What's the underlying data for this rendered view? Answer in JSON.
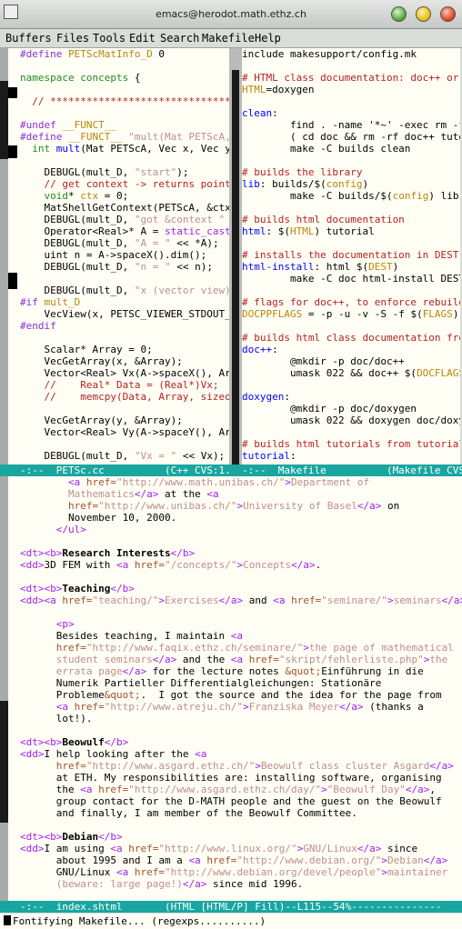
{
  "window": {
    "title": "emacs@herodot.math.ethz.ch"
  },
  "menu": [
    "Buffers",
    "Files",
    "Tools",
    "Edit",
    "Search",
    "Makefile",
    "Help"
  ],
  "left_pane": {
    "lines": [
      [
        [
          "pre",
          "#define "
        ],
        [
          "var",
          "PETScMatInfo_D"
        ],
        [
          "def",
          " 0"
        ]
      ],
      [
        [
          "def",
          ""
        ]
      ],
      [
        [
          "type",
          "namespace"
        ],
        [
          "def",
          " "
        ],
        [
          "type",
          "concepts"
        ],
        [
          "def",
          " {"
        ]
      ],
      [
        [
          "def",
          ""
        ]
      ],
      [
        [
          "com",
          "  // ************************************$"
        ]
      ],
      [
        [
          "def",
          ""
        ]
      ],
      [
        [
          "pre",
          "#undef "
        ],
        [
          "var",
          "__FUNCT__"
        ]
      ],
      [
        [
          "pre",
          "#define "
        ],
        [
          "var",
          "__FUNCT__"
        ],
        [
          "str",
          " \"mult(Mat PETScA, V$"
        ]
      ],
      [
        [
          "def",
          "  "
        ],
        [
          "type",
          "int"
        ],
        [
          "def",
          " "
        ],
        [
          "fn",
          "mult"
        ],
        [
          "def",
          "(Mat PETScA, Vec x, Vec y) $"
        ]
      ],
      [
        [
          "def",
          ""
        ]
      ],
      [
        [
          "def",
          "    DEBUGL(mult_D, "
        ],
        [
          "str",
          "\"start\""
        ],
        [
          "def",
          ");"
        ]
      ],
      [
        [
          "com",
          "    // get context -> returns pointer$"
        ]
      ],
      [
        [
          "def",
          "    "
        ],
        [
          "type",
          "void"
        ],
        [
          "def",
          "* "
        ],
        [
          "var",
          "ctx"
        ],
        [
          "def",
          " = 0;"
        ]
      ],
      [
        [
          "def",
          "    MatShellGetContext(PETScA, &ctx);$"
        ]
      ],
      [
        [
          "def",
          "    DEBUGL(mult_D, "
        ],
        [
          "str",
          "\"got &context \""
        ],
        [
          "def",
          " <<$"
        ]
      ],
      [
        [
          "def",
          "    Operator<Real>* A = "
        ],
        [
          "kw",
          "static_cast"
        ],
        [
          "type",
          "<O$"
        ]
      ],
      [
        [
          "def",
          "    DEBUGL(mult_D, "
        ],
        [
          "str",
          "\"A = \""
        ],
        [
          "def",
          " << *A);"
        ]
      ],
      [
        [
          "def",
          "    uint n = A->spaceX().dim();"
        ]
      ],
      [
        [
          "def",
          "    DEBUGL(mult_D, "
        ],
        [
          "str",
          "\"n = \""
        ],
        [
          "def",
          " << n);"
        ]
      ],
      [
        [
          "def",
          ""
        ]
      ],
      [
        [
          "def",
          "    DEBUGL(mult_D, "
        ],
        [
          "str",
          "\"x (vector view)\""
        ],
        [
          "def",
          ")$"
        ]
      ],
      [
        [
          "pre",
          "#if "
        ],
        [
          "var",
          "mult_D"
        ]
      ],
      [
        [
          "def",
          "    VecView(x, PETSC_VIEWER_STDOUT_SE$"
        ]
      ],
      [
        [
          "pre",
          "#endif"
        ]
      ],
      [
        [
          "def",
          ""
        ]
      ],
      [
        [
          "def",
          "    Scalar* Array = 0;"
        ]
      ],
      [
        [
          "def",
          "    VecGetArray(x, &Array);"
        ]
      ],
      [
        [
          "def",
          "    Vector<Real> Vx(A->spaceX(), Arra$"
        ]
      ],
      [
        [
          "com",
          "    //    Real* Data = (Real*)Vx;"
        ]
      ],
      [
        [
          "com",
          "    //    memcpy(Data, Array, sizeof($"
        ]
      ],
      [
        [
          "def",
          ""
        ]
      ],
      [
        [
          "def",
          "    VecGetArray(y, &Array);"
        ]
      ],
      [
        [
          "def",
          "    Vector<Real> Vy(A->spaceY(), Arra$"
        ]
      ],
      [
        [
          "def",
          ""
        ]
      ],
      [
        [
          "def",
          "    DEBUGL(mult_D, "
        ],
        [
          "str",
          "\"Vx = \""
        ],
        [
          "def",
          " << Vx);"
        ]
      ]
    ],
    "modeline": "-:--  PETSc.cc          (C++ CVS:1.1)-"
  },
  "right_pane": {
    "lines": [
      [
        [
          "def",
          "include makesupport/config.mk"
        ]
      ],
      [
        [
          "def",
          ""
        ]
      ],
      [
        [
          "com",
          "# HTML class documentation: doc++ or d$"
        ]
      ],
      [
        [
          "var",
          "HTML"
        ],
        [
          "def",
          "=doxygen"
        ]
      ],
      [
        [
          "def",
          ""
        ]
      ],
      [
        [
          "fn",
          "clean"
        ],
        [
          "def",
          ":"
        ]
      ],
      [
        [
          "def",
          "        find . -name '*~' -exec rm -f $"
        ]
      ],
      [
        [
          "def",
          "        ( cd doc && rm -rf doc++ tutor$"
        ]
      ],
      [
        [
          "def",
          "        make -C builds clean"
        ]
      ],
      [
        [
          "def",
          ""
        ]
      ],
      [
        [
          "com",
          "# builds the library"
        ]
      ],
      [
        [
          "fn",
          "lib"
        ],
        [
          "def",
          ": builds/$("
        ],
        [
          "var",
          "config"
        ],
        [
          "def",
          ")"
        ]
      ],
      [
        [
          "def",
          "        make -C builds/$("
        ],
        [
          "var",
          "config"
        ],
        [
          "def",
          ") lib"
        ]
      ],
      [
        [
          "def",
          ""
        ]
      ],
      [
        [
          "com",
          "# builds html documentation"
        ]
      ],
      [
        [
          "fn",
          "html"
        ],
        [
          "def",
          ": $("
        ],
        [
          "var",
          "HTML"
        ],
        [
          "def",
          ") tutorial"
        ]
      ],
      [
        [
          "def",
          ""
        ]
      ],
      [
        [
          "com",
          "# installs the documentation in DEST"
        ]
      ],
      [
        [
          "fn",
          "html-install"
        ],
        [
          "def",
          ": html $("
        ],
        [
          "var",
          "DEST"
        ],
        [
          "def",
          ")"
        ]
      ],
      [
        [
          "def",
          "        make -C doc html-install DEST=$"
        ]
      ],
      [
        [
          "def",
          ""
        ]
      ],
      [
        [
          "com",
          "# flags for doc++, to enforce rebuild $"
        ]
      ],
      [
        [
          "var",
          "DOCPPFLAGS"
        ],
        [
          "def",
          " = -p -u -v -S -f $("
        ],
        [
          "var",
          "FLAGS"
        ],
        [
          "def",
          ")"
        ]
      ],
      [
        [
          "def",
          ""
        ]
      ],
      [
        [
          "com",
          "# builds html class documentation from$"
        ]
      ],
      [
        [
          "fn",
          "doc++"
        ],
        [
          "def",
          ":"
        ]
      ],
      [
        [
          "def",
          "        @mkdir -p doc/doc++"
        ]
      ],
      [
        [
          "def",
          "        umask 022 && doc++ $("
        ],
        [
          "var",
          "DOCFLAGS"
        ],
        [
          "def",
          ")$"
        ]
      ],
      [
        [
          "def",
          ""
        ]
      ],
      [
        [
          "fn",
          "doxygen"
        ],
        [
          "def",
          ":"
        ]
      ],
      [
        [
          "def",
          "        @mkdir -p doc/doxygen"
        ]
      ],
      [
        [
          "def",
          "        umask 022 && doxygen doc/doxyg$"
        ]
      ],
      [
        [
          "def",
          ""
        ]
      ],
      [
        [
          "com",
          "# builds html tutorials from tutorial $"
        ]
      ],
      [
        [
          "fn",
          "tutorial"
        ],
        [
          "def",
          ":"
        ]
      ]
    ],
    "modeline": "-:--  Makefile          (Makefile CVS-1"
  },
  "bottom_pane": {
    "lines": [
      [
        [
          "def",
          "        "
        ],
        [
          "tag",
          "<a "
        ],
        [
          "attr",
          "href="
        ],
        [
          "str",
          "\"http://www.math.unibas.ch/\""
        ],
        [
          "tag",
          ">"
        ],
        [
          "str",
          "Department of"
        ]
      ],
      [
        [
          "def",
          "        "
        ],
        [
          "str",
          "Mathematics"
        ],
        [
          "tag",
          "</a>"
        ],
        [
          "def",
          " at the "
        ],
        [
          "tag",
          "<a"
        ]
      ],
      [
        [
          "def",
          "        "
        ],
        [
          "attr",
          "href="
        ],
        [
          "str",
          "\"http://www.unibas.ch/\""
        ],
        [
          "tag",
          ">"
        ],
        [
          "str",
          "University of Basel"
        ],
        [
          "tag",
          "</a>"
        ],
        [
          "def",
          " on"
        ]
      ],
      [
        [
          "def",
          "        November 10, 2000."
        ]
      ],
      [
        [
          "def",
          "      "
        ],
        [
          "tag",
          "</ul>"
        ]
      ],
      [
        [
          "def",
          ""
        ]
      ],
      [
        [
          "tag",
          "<dt><b>"
        ],
        [
          "bold",
          "Research Interests"
        ],
        [
          "tag",
          "</b>"
        ]
      ],
      [
        [
          "tag",
          "<dd>"
        ],
        [
          "def",
          "3D FEM with "
        ],
        [
          "tag",
          "<a "
        ],
        [
          "attr",
          "href="
        ],
        [
          "str",
          "\"/concepts/\""
        ],
        [
          "tag",
          ">"
        ],
        [
          "str",
          "Concepts"
        ],
        [
          "tag",
          "</a>"
        ],
        [
          "def",
          "."
        ]
      ],
      [
        [
          "def",
          ""
        ]
      ],
      [
        [
          "tag",
          "<dt><b>"
        ],
        [
          "bold",
          "Teaching"
        ],
        [
          "tag",
          "</b>"
        ]
      ],
      [
        [
          "tag",
          "<dd><a "
        ],
        [
          "attr",
          "href="
        ],
        [
          "str",
          "\"teaching/\""
        ],
        [
          "tag",
          ">"
        ],
        [
          "str",
          "Exercises"
        ],
        [
          "tag",
          "</a>"
        ],
        [
          "def",
          " and "
        ],
        [
          "tag",
          "<a "
        ],
        [
          "attr",
          "href="
        ],
        [
          "str",
          "\"seminare/\""
        ],
        [
          "tag",
          ">"
        ],
        [
          "str",
          "seminars"
        ],
        [
          "tag",
          "</a>"
        ],
        [
          "def",
          "."
        ]
      ],
      [
        [
          "def",
          ""
        ]
      ],
      [
        [
          "def",
          "      "
        ],
        [
          "tag",
          "<p>"
        ]
      ],
      [
        [
          "def",
          "      Besides teaching, I maintain "
        ],
        [
          "tag",
          "<a"
        ]
      ],
      [
        [
          "def",
          "      "
        ],
        [
          "attr",
          "href="
        ],
        [
          "str",
          "\"http://www.faqix.ethz.ch/seminare/\""
        ],
        [
          "tag",
          ">"
        ],
        [
          "str",
          "the page of mathematical"
        ]
      ],
      [
        [
          "def",
          "      "
        ],
        [
          "str",
          "student seminars"
        ],
        [
          "tag",
          "</a>"
        ],
        [
          "def",
          " and the "
        ],
        [
          "tag",
          "<a "
        ],
        [
          "attr",
          "href="
        ],
        [
          "str",
          "\"skript/fehlerliste.php\""
        ],
        [
          "tag",
          ">"
        ],
        [
          "str",
          "the"
        ]
      ],
      [
        [
          "def",
          "      "
        ],
        [
          "str",
          "errata page"
        ],
        [
          "tag",
          "</a>"
        ],
        [
          "def",
          " for the lecture notes "
        ],
        [
          "attr",
          "&quot;"
        ],
        [
          "def",
          "Einführung in die"
        ]
      ],
      [
        [
          "def",
          "      Numerik Partieller Differentialgleichungen: Stationäre"
        ]
      ],
      [
        [
          "def",
          "      Probleme"
        ],
        [
          "attr",
          "&quot;"
        ],
        [
          "def",
          ".  I got the source and the idea for the page from"
        ]
      ],
      [
        [
          "def",
          "      "
        ],
        [
          "tag",
          "<a "
        ],
        [
          "attr",
          "href="
        ],
        [
          "str",
          "\"http://www.atreju.ch/\""
        ],
        [
          "tag",
          ">"
        ],
        [
          "str",
          "Franziska Meyer"
        ],
        [
          "tag",
          "</a>"
        ],
        [
          "def",
          " (thanks a"
        ]
      ],
      [
        [
          "def",
          "      lot!)."
        ]
      ],
      [
        [
          "def",
          ""
        ]
      ],
      [
        [
          "tag",
          "<dt><b>"
        ],
        [
          "bold",
          "Beowulf"
        ],
        [
          "tag",
          "</b>"
        ]
      ],
      [
        [
          "tag",
          "<dd>"
        ],
        [
          "def",
          "I help looking after the "
        ],
        [
          "tag",
          "<a"
        ]
      ],
      [
        [
          "def",
          "      "
        ],
        [
          "attr",
          "href="
        ],
        [
          "str",
          "\"http://www.asgard.ethz.ch/\""
        ],
        [
          "tag",
          ">"
        ],
        [
          "str",
          "Beowulf class cluster Asgard"
        ],
        [
          "tag",
          "</a>"
        ]
      ],
      [
        [
          "def",
          "      at ETH. My responsibilities are: installing software, organising"
        ]
      ],
      [
        [
          "def",
          "      the "
        ],
        [
          "tag",
          "<a "
        ],
        [
          "attr",
          "href="
        ],
        [
          "str",
          "\"http://www.asgard.ethz.ch/day/\""
        ],
        [
          "tag",
          ">"
        ],
        [
          "str",
          "\"Beowulf Day\""
        ],
        [
          "tag",
          "</a>"
        ],
        [
          "def",
          ","
        ]
      ],
      [
        [
          "def",
          "      group contact for the D-MATH people and the guest on the Beowulf"
        ]
      ],
      [
        [
          "def",
          "      and finally, I am member of the Beowulf Committee."
        ]
      ],
      [
        [
          "def",
          ""
        ]
      ],
      [
        [
          "tag",
          "<dt><b>"
        ],
        [
          "bold",
          "Debian"
        ],
        [
          "tag",
          "</b>"
        ]
      ],
      [
        [
          "tag",
          "<dd>"
        ],
        [
          "def",
          "I am using "
        ],
        [
          "tag",
          "<a "
        ],
        [
          "attr",
          "href="
        ],
        [
          "str",
          "\"http://www.linux.org/\""
        ],
        [
          "tag",
          ">"
        ],
        [
          "str",
          "GNU/Linux"
        ],
        [
          "tag",
          "</a>"
        ],
        [
          "def",
          " since"
        ]
      ],
      [
        [
          "def",
          "      about 1995 and I am a "
        ],
        [
          "tag",
          "<a "
        ],
        [
          "attr",
          "href="
        ],
        [
          "str",
          "\"http://www.debian.org/\""
        ],
        [
          "tag",
          ">"
        ],
        [
          "str",
          "Debian"
        ],
        [
          "tag",
          "</a>"
        ]
      ],
      [
        [
          "def",
          "      GNU/Linux "
        ],
        [
          "tag",
          "<a "
        ],
        [
          "attr",
          "href="
        ],
        [
          "str",
          "\"http://www.debian.org/devel/people\""
        ],
        [
          "tag",
          ">"
        ],
        [
          "str",
          "maintainer"
        ]
      ],
      [
        [
          "def",
          "      "
        ],
        [
          "str",
          "(beware: large page!)"
        ],
        [
          "tag",
          "</a>"
        ],
        [
          "def",
          " since mid 1996."
        ]
      ]
    ],
    "modeline": "-:--  index.shtml       (HTML [HTML/P] Fill)--L115--54%---------------"
  },
  "minibuffer": {
    "text": "Fontifying Makefile... (regexps..........)"
  },
  "colors": {
    "background": "#fffef4",
    "modeline": "#1aa6a0",
    "comment": "#b22222",
    "string": "#bc8f8f",
    "keyword": "#a020f0",
    "function": "#0000ff",
    "type": "#228b22",
    "variable": "#b8860b"
  }
}
